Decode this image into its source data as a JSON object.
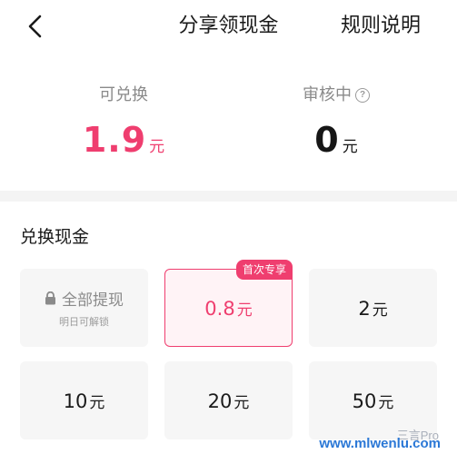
{
  "header": {
    "back_icon": "chevron-left-icon",
    "title": "分享领现金",
    "rules_label": "规则说明"
  },
  "stats": {
    "redeemable": {
      "label": "可兑换",
      "value": "1.9",
      "unit": "元",
      "color": "#ef3e6f"
    },
    "reviewing": {
      "label": "审核中",
      "help_icon": "question-circle-icon",
      "help_glyph": "?",
      "value": "0",
      "unit": "元"
    }
  },
  "exchange": {
    "section_title": "兑换现金",
    "locked_tile": {
      "lock_icon": "lock-icon",
      "label": "全部提现",
      "sublabel": "明日可解锁"
    },
    "options": [
      {
        "amount": "0.8",
        "unit": "元",
        "badge": "首次专享",
        "selected": true
      },
      {
        "amount": "2",
        "unit": "元"
      },
      {
        "amount": "10",
        "unit": "元"
      },
      {
        "amount": "20",
        "unit": "元"
      },
      {
        "amount": "50",
        "unit": "元"
      }
    ]
  },
  "watermark": {
    "line1": "三言Pro",
    "line2": "www.mlwenlu.com"
  },
  "colors": {
    "accent": "#ef3e6f",
    "selected_bg": "#fff3f6",
    "tile_bg": "#f6f6f6",
    "divider": "#f4f4f4"
  }
}
